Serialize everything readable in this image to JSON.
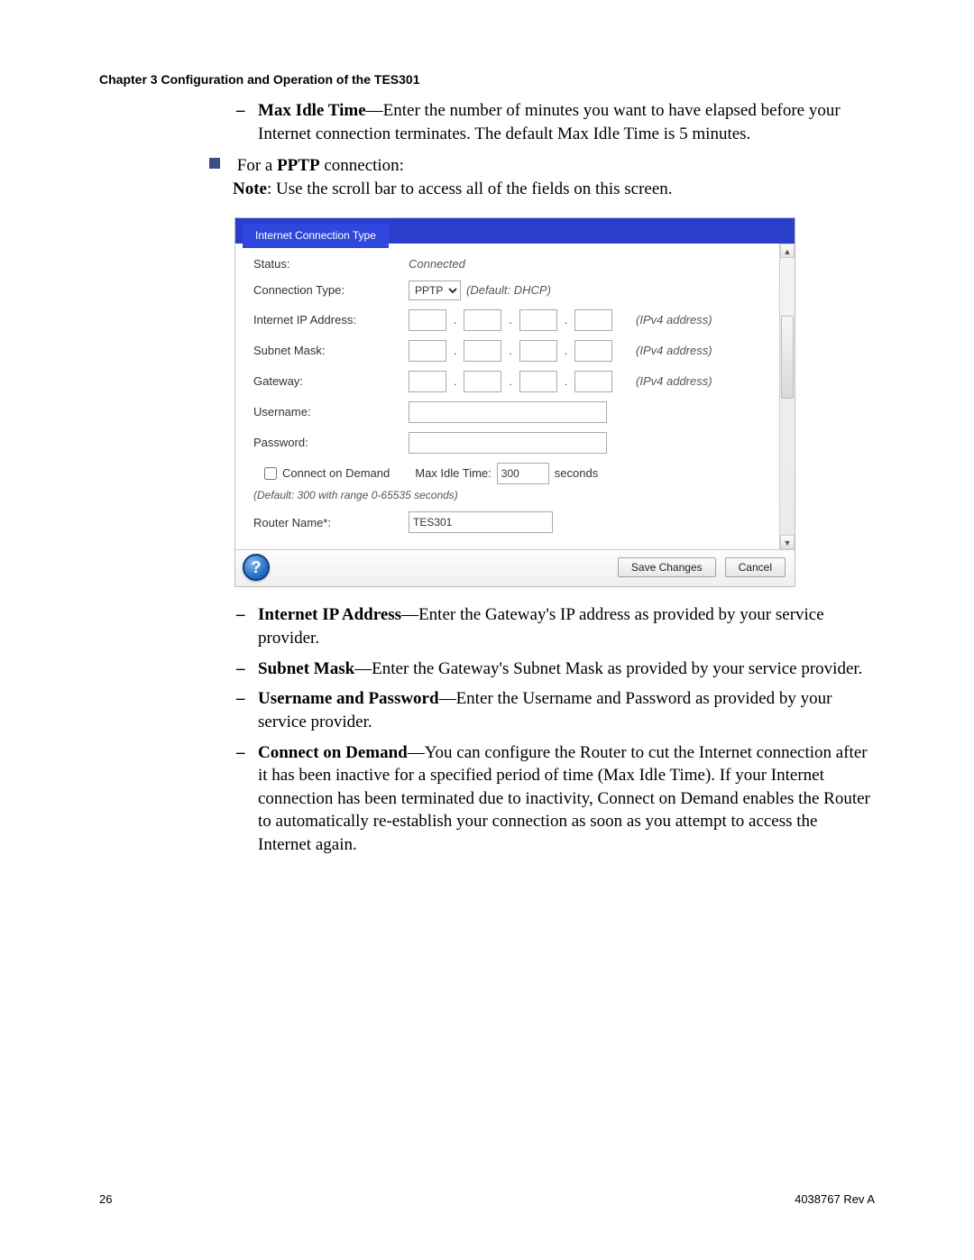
{
  "chapter_heading": "Chapter 3    Configuration and Operation of the TES301",
  "intro_item": {
    "term": "Max Idle Time",
    "desc": "—Enter the number of minutes you want to have elapsed before your Internet connection terminates. The default Max Idle Time is 5 minutes."
  },
  "bullet_intro": {
    "prefix": "For a ",
    "bold": "PPTP",
    "suffix": " connection:"
  },
  "note_label": "Note",
  "note_text": ": Use the scroll bar to access all of the fields on this screen.",
  "screenshot": {
    "tab_label": "Internet Connection Type",
    "status_label": "Status:",
    "status_value": "Connected",
    "conn_type_label": "Connection Type:",
    "conn_type_value": "PPTP",
    "conn_type_hint": "(Default: DHCP)",
    "ip_label": "Internet IP Address:",
    "subnet_label": "Subnet Mask:",
    "gateway_label": "Gateway:",
    "ipv4_hint": "(IPv4 address)",
    "username_label": "Username:",
    "password_label": "Password:",
    "cod_label": "Connect on Demand",
    "max_idle_label": "Max Idle Time:",
    "max_idle_value": "300",
    "max_idle_unit": "seconds",
    "cod_hint": "(Default: 300 with range 0-65535 seconds)",
    "router_name_label": "Router Name*:",
    "router_name_value": "TES301",
    "save_button": "Save Changes",
    "cancel_button": "Cancel",
    "help_glyph": "?"
  },
  "definitions": [
    {
      "term": "Internet IP Address",
      "desc": "—Enter the Gateway's IP address as provided by your service provider."
    },
    {
      "term": "Subnet Mask",
      "desc": "—Enter the Gateway's Subnet Mask as provided by your service provider."
    },
    {
      "term": "Username and Password",
      "desc": "—Enter the Username and Password as provided by your service provider."
    },
    {
      "term": "Connect on Demand",
      "desc": "—You can configure the Router to cut the Internet connection after it has been inactive for a specified period of time (Max Idle Time). If your Internet connection has been terminated due to inactivity, Connect on Demand enables the Router to automatically re-establish your connection as soon as you attempt to access the Internet again."
    }
  ],
  "footer": {
    "page_number": "26",
    "doc_id": "4038767 Rev A"
  }
}
